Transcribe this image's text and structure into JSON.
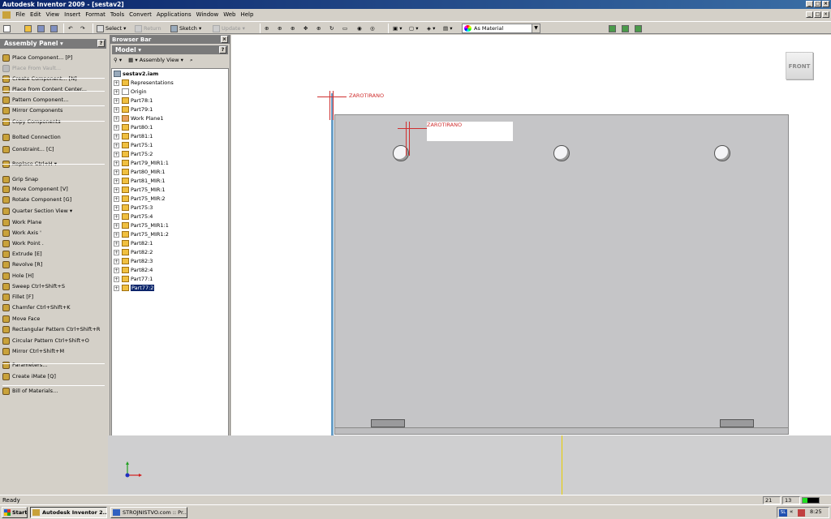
{
  "window": {
    "title": "Autodesk Inventor 2009 - [sestav2]"
  },
  "menubar": [
    "File",
    "Edit",
    "View",
    "Insert",
    "Format",
    "Tools",
    "Convert",
    "Applications",
    "Window",
    "Web",
    "Help"
  ],
  "toolbar": {
    "select_label": "Select",
    "return_label": "Return",
    "sketch_label": "Sketch",
    "update_label": "Update",
    "material_value": "As Material"
  },
  "assembly_panel": {
    "title": "Assembly Panel",
    "commands": [
      {
        "label": "Place Component...   [P]",
        "icon": "place-component-icon"
      },
      {
        "label": "Place From Vault...",
        "icon": "vault-icon",
        "disabled": true
      },
      {
        "label": "Create Component...   [N]",
        "icon": "create-component-icon"
      },
      {
        "label": "Place from Content Center...",
        "icon": "content-center-icon"
      },
      {
        "label": "Pattern Component...",
        "icon": "pattern-icon"
      },
      {
        "label": "Mirror Components",
        "icon": "mirror-icon"
      },
      {
        "label": "Copy Components",
        "icon": "copy-icon"
      },
      {
        "label": "Bolted Connection",
        "icon": "bolt-icon"
      },
      {
        "label": "Constraint...   [C]",
        "icon": "constraint-icon"
      },
      {
        "label": "Replace   Ctrl+H  ▾",
        "icon": "replace-icon"
      },
      {
        "label": "Grip Snap",
        "icon": "grip-snap-icon"
      },
      {
        "label": "Move Component   [V]",
        "icon": "move-icon"
      },
      {
        "label": "Rotate Component   [G]",
        "icon": "rotate-icon"
      },
      {
        "label": "Quarter Section View  ▾",
        "icon": "section-icon"
      },
      {
        "label": "Work Plane",
        "icon": "work-plane-icon"
      },
      {
        "label": "Work Axis  '",
        "icon": "work-axis-icon"
      },
      {
        "label": "Work Point  .",
        "icon": "work-point-icon"
      },
      {
        "label": "Extrude   [E]",
        "icon": "extrude-icon"
      },
      {
        "label": "Revolve   [R]",
        "icon": "revolve-icon"
      },
      {
        "label": "Hole   [H]",
        "icon": "hole-icon"
      },
      {
        "label": "Sweep   Ctrl+Shift+S",
        "icon": "sweep-icon"
      },
      {
        "label": "Fillet   [F]",
        "icon": "fillet-icon"
      },
      {
        "label": "Chamfer   Ctrl+Shift+K",
        "icon": "chamfer-icon"
      },
      {
        "label": "Move Face",
        "icon": "move-face-icon"
      },
      {
        "label": "Rectangular Pattern   Ctrl+Shift+R",
        "icon": "rect-pattern-icon"
      },
      {
        "label": "Circular Pattern   Ctrl+Shift+O",
        "icon": "circ-pattern-icon"
      },
      {
        "label": "Mirror   Ctrl+Shift+M",
        "icon": "mirror-feature-icon"
      },
      {
        "label": "Parameters...",
        "icon": "parameters-icon"
      },
      {
        "label": "Create iMate   [Q]",
        "icon": "imate-icon"
      },
      {
        "label": "Bill of Materials...",
        "icon": "bom-icon"
      }
    ]
  },
  "browser": {
    "title": "Browser Bar",
    "model_label": "Model",
    "filter_label": "Assembly View",
    "root": "sestav2.iam",
    "nodes": [
      "Representations",
      "Origin",
      "Part78:1",
      "Part79:1",
      "Work Plane1",
      "Part80:1",
      "Part81:1",
      "Part75:1",
      "Part75:2",
      "Part79_MIR1:1",
      "Part80_MIR:1",
      "Part81_MIR:1",
      "Part75_MIR:1",
      "Part75_MIR:2",
      "Part75:3",
      "Part75:4",
      "Part75_MIR1:1",
      "Part75_MIR1:2",
      "Part82:1",
      "Part82:2",
      "Part82:3",
      "Part82:4",
      "Part77:1",
      "Part77:2"
    ],
    "selected": "Part77:2"
  },
  "viewport": {
    "viewcube_label": "FRONT",
    "annotations": [
      "ZAROTIRANO",
      "ZAROTIRANO"
    ]
  },
  "status": {
    "text": "Ready",
    "count1": "21",
    "count2": "13"
  },
  "taskbar": {
    "start": "Start",
    "tasks": [
      "Autodesk Inventor 2...",
      "STROJNISTVO.com :: Pr..."
    ],
    "clock": "8:25",
    "lang": "SL"
  }
}
